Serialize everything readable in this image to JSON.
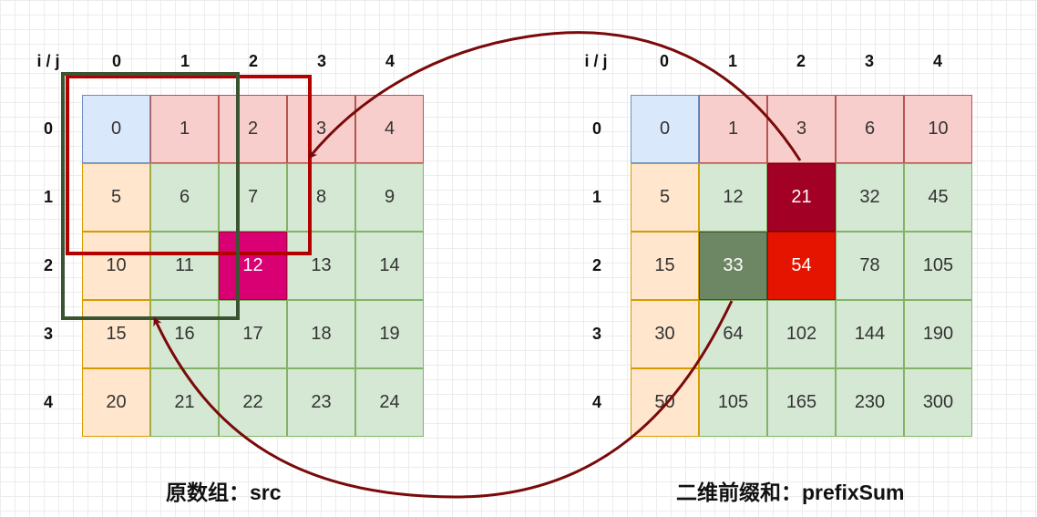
{
  "left_grid": {
    "corner_label": "i / j",
    "col_headers": [
      "0",
      "1",
      "2",
      "3",
      "4"
    ],
    "row_headers": [
      "0",
      "1",
      "2",
      "3",
      "4"
    ],
    "cells": [
      [
        "0",
        "1",
        "2",
        "3",
        "4"
      ],
      [
        "5",
        "6",
        "7",
        "8",
        "9"
      ],
      [
        "10",
        "11",
        "12",
        "13",
        "14"
      ],
      [
        "15",
        "16",
        "17",
        "18",
        "19"
      ],
      [
        "20",
        "21",
        "22",
        "23",
        "24"
      ]
    ],
    "caption": "原数组：src"
  },
  "right_grid": {
    "corner_label": "i / j",
    "col_headers": [
      "0",
      "1",
      "2",
      "3",
      "4"
    ],
    "row_headers": [
      "0",
      "1",
      "2",
      "3",
      "4"
    ],
    "cells": [
      [
        "0",
        "1",
        "3",
        "6",
        "10"
      ],
      [
        "5",
        "12",
        "21",
        "32",
        "45"
      ],
      [
        "15",
        "33",
        "54",
        "78",
        "105"
      ],
      [
        "30",
        "64",
        "102",
        "144",
        "190"
      ],
      [
        "50",
        "105",
        "165",
        "230",
        "300"
      ]
    ],
    "caption": "二维前缀和：prefixSum"
  },
  "colors": {
    "first_cell": "#dae8fc",
    "first_row": "#f8cecc",
    "first_col": "#ffe6cc",
    "body": "#d5e8d4",
    "src_target": "#d80073",
    "prefix_top": "#a20025",
    "prefix_left": "#6d8764",
    "prefix_result": "#e51400",
    "arrow": "#7a0a0a",
    "highlight_red": "#b20000",
    "highlight_green": "#3a5431"
  }
}
